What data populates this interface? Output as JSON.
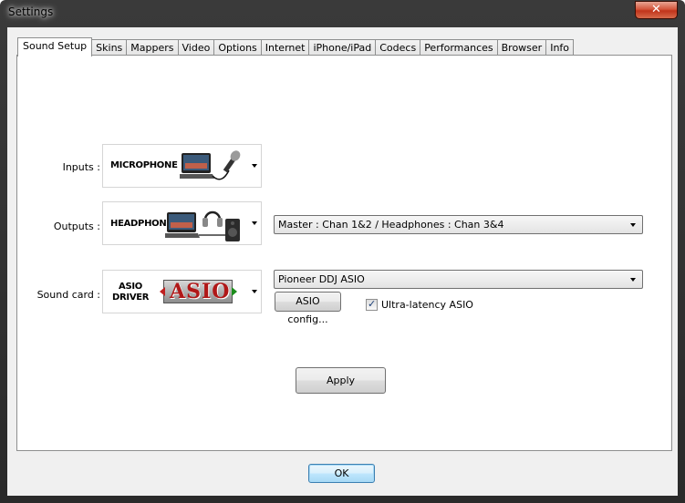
{
  "window": {
    "title": "Settings",
    "close_label": "✕"
  },
  "tabs": [
    {
      "label": "Sound Setup",
      "active": true
    },
    {
      "label": "Skins"
    },
    {
      "label": "Mappers"
    },
    {
      "label": "Video"
    },
    {
      "label": "Options"
    },
    {
      "label": "Internet"
    },
    {
      "label": "iPhone/iPad"
    },
    {
      "label": "Codecs"
    },
    {
      "label": "Performances"
    },
    {
      "label": "Browser"
    },
    {
      "label": "Info"
    }
  ],
  "sound_setup": {
    "inputs": {
      "label": "Inputs :",
      "image_caption": "MICROPHONE"
    },
    "outputs": {
      "label": "Outputs :",
      "image_caption": "HEADPHONES",
      "routing_value": "Master : Chan 1&2 / Headphones : Chan 3&4"
    },
    "sound_card": {
      "label": "Sound card :",
      "image_caption_line1": "ASIO",
      "image_caption_line2": "DRIVER",
      "logo_text": "ASIO",
      "device_value": "Pioneer DDJ ASIO",
      "config_button": "ASIO config...",
      "ultra_latency_label": "Ultra-latency ASIO",
      "ultra_latency_checked": true
    },
    "apply_button": "Apply"
  },
  "footer": {
    "ok_button": "OK"
  },
  "colors": {
    "frame": "#2e2e2e",
    "client": "#f0f0f0",
    "close": "#c7432a",
    "default_button_border": "#3c7fb1"
  }
}
